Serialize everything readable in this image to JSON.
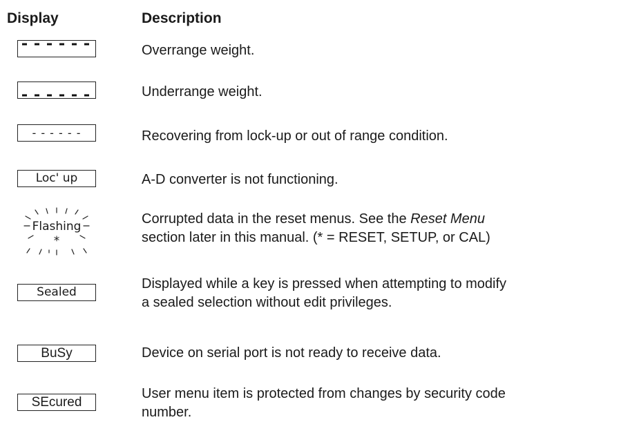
{
  "table": {
    "header_display": "Display",
    "header_description": "Description"
  },
  "rows": [
    {
      "display": "",
      "display_style": "dashes-top",
      "description": "Overrange weight."
    },
    {
      "display": "",
      "display_style": "dashes-bottom",
      "description": "Underrange weight."
    },
    {
      "display": "- - - - - -",
      "description": "Recovering from lock-up or out of range condition."
    },
    {
      "display": "Loc' up",
      "description": "A-D converter is not functioning."
    },
    {
      "display": "Flashing",
      "display_sub": "*",
      "display_style": "flashing",
      "description_pre": "Corrupted data in the reset menus. See the ",
      "description_italic": "Reset Menu",
      "description_line2": "section later in this manual. (* = RESET, SETUP, or CAL)"
    },
    {
      "display": "Sealed",
      "description_line1": "Displayed while a key is pressed when attempting to modify",
      "description_line2": "a sealed selection without edit privileges."
    },
    {
      "display": "BuSy",
      "description": "Device on serial port is not ready to receive data."
    },
    {
      "display": "SEcured",
      "description_line1": "User menu item is protected from changes by security code",
      "description_line2": "number."
    }
  ]
}
